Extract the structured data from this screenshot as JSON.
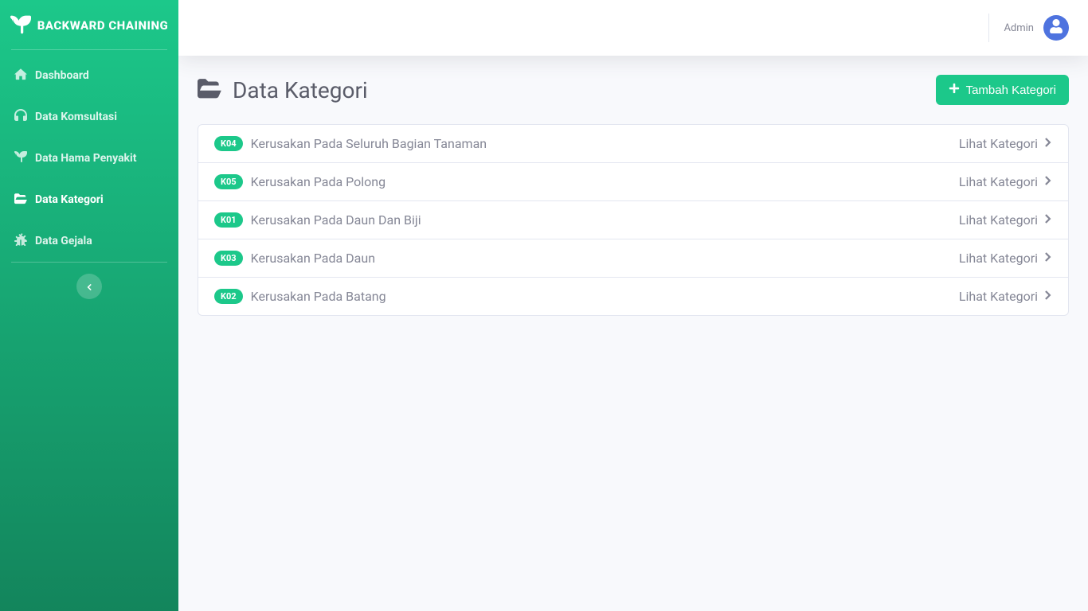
{
  "brand": "BACKWARD CHAINING",
  "sidebar": {
    "items": [
      {
        "label": "Dashboard",
        "icon": "home-icon"
      },
      {
        "label": "Data Komsultasi",
        "icon": "headset-icon"
      },
      {
        "label": "Data Hama Penyakit",
        "icon": "leaf-icon"
      },
      {
        "label": "Data Kategori",
        "icon": "folder-open-icon",
        "active": true
      },
      {
        "label": "Data Gejala",
        "icon": "bug-icon"
      }
    ]
  },
  "topbar": {
    "user_name": "Admin"
  },
  "page": {
    "title": "Data Kategori",
    "add_button": "Tambah Kategori",
    "item_link_label": "Lihat Kategori",
    "categories": [
      {
        "code": "K04",
        "name": "Kerusakan Pada Seluruh Bagian Tanaman"
      },
      {
        "code": "K05",
        "name": "Kerusakan Pada Polong"
      },
      {
        "code": "K01",
        "name": "Kerusakan Pada Daun Dan Biji"
      },
      {
        "code": "K03",
        "name": "Kerusakan Pada Daun"
      },
      {
        "code": "K02",
        "name": "Kerusakan Pada Batang"
      }
    ]
  }
}
